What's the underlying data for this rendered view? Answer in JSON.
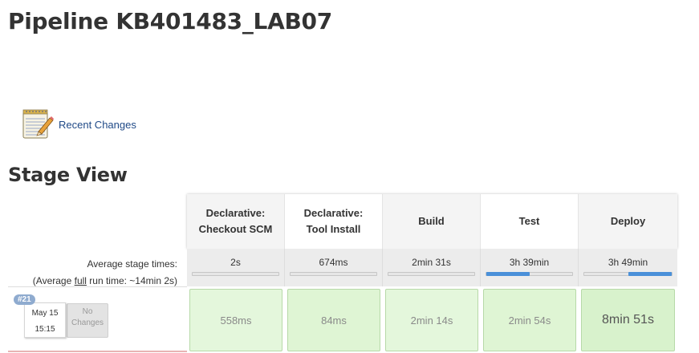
{
  "page": {
    "title": "Pipeline KB401483_LAB07"
  },
  "recent_changes": {
    "label": "Recent Changes",
    "icon": "notepad-icon"
  },
  "stage_view": {
    "title": "Stage View",
    "avg_label": "Average stage times:",
    "avg_run_prefix": "(Average ",
    "avg_run_full": "full",
    "avg_run_suffix": " run time: ~14min 2s)",
    "stages": [
      {
        "name_line1": "Declarative:",
        "name_line2": "Checkout SCM",
        "avg": "2s",
        "progress": 0.0
      },
      {
        "name_line1": "Declarative:",
        "name_line2": "Tool Install",
        "avg": "674ms",
        "progress": 0.0
      },
      {
        "name_line1": "Build",
        "name_line2": "",
        "avg": "2min 31s",
        "progress": 0.0
      },
      {
        "name_line1": "Test",
        "name_line2": "",
        "avg": "3h 39min",
        "progress_start": 0.0,
        "progress": 0.5
      },
      {
        "name_line1": "Deploy",
        "name_line2": "",
        "avg": "3h 49min",
        "progress_start": 0.5,
        "progress": 1.0
      }
    ],
    "run": {
      "badge": "#21",
      "date": "May 15",
      "time": "15:15",
      "no_changes_line1": "No",
      "no_changes_line2": "Changes",
      "stage_times": [
        "558ms",
        "84ms",
        "2min 14s",
        "2min 54s",
        "8min 51s"
      ]
    }
  }
}
